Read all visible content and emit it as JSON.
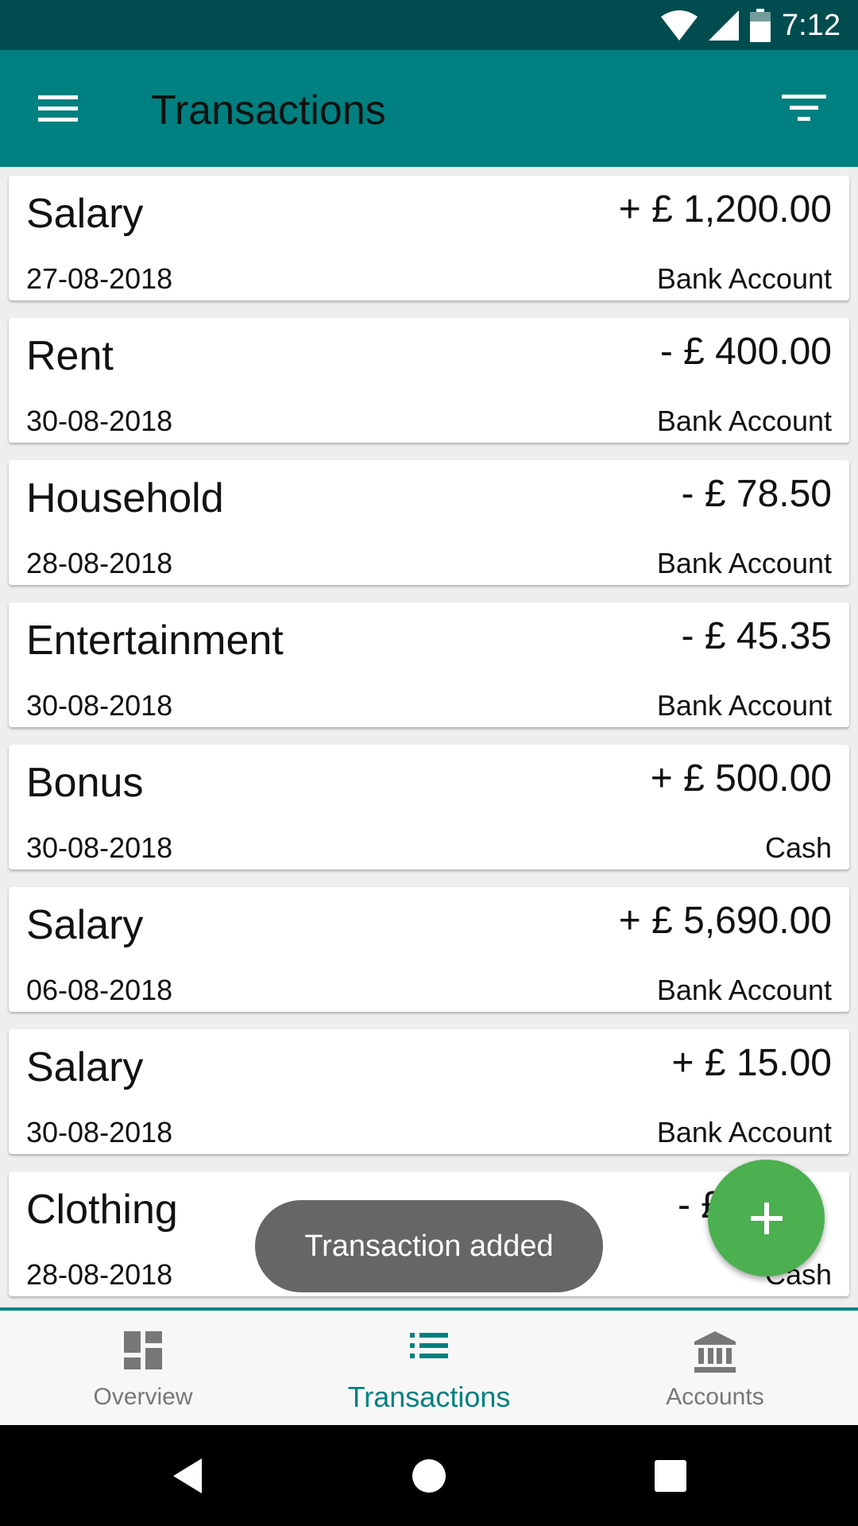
{
  "status_bar": {
    "time": "7:12",
    "icons": [
      "wifi-icon",
      "signal-icon",
      "battery-icon"
    ]
  },
  "app_bar": {
    "title": "Transactions",
    "menu_icon": "menu-icon",
    "filter_icon": "filter-icon"
  },
  "transactions": [
    {
      "title": "Salary",
      "amount": "+ £ 1,200.00",
      "date": "27-08-2018",
      "account": "Bank Account"
    },
    {
      "title": "Rent",
      "amount": "- £ 400.00",
      "date": "30-08-2018",
      "account": "Bank Account"
    },
    {
      "title": "Household",
      "amount": "- £ 78.50",
      "date": "28-08-2018",
      "account": "Bank Account"
    },
    {
      "title": "Entertainment",
      "amount": "- £ 45.35",
      "date": "30-08-2018",
      "account": "Bank Account"
    },
    {
      "title": "Bonus",
      "amount": "+ £ 500.00",
      "date": "30-08-2018",
      "account": "Cash"
    },
    {
      "title": "Salary",
      "amount": "+ £ 5,690.00",
      "date": "06-08-2018",
      "account": "Bank Account"
    },
    {
      "title": "Salary",
      "amount": "+ £ 15.00",
      "date": "30-08-2018",
      "account": "Bank Account"
    },
    {
      "title": "Clothing",
      "amount": "- £",
      "date": "28-08-2018",
      "account": "Cash"
    }
  ],
  "toast": {
    "text": "Transaction added"
  },
  "fab": {
    "icon": "add-icon"
  },
  "bottom_nav": {
    "items": [
      {
        "label": "Overview",
        "icon": "dashboard-icon"
      },
      {
        "label": "Transactions",
        "icon": "list-icon",
        "active": true
      },
      {
        "label": "Accounts",
        "icon": "bank-icon"
      }
    ]
  },
  "colors": {
    "primary": "#008080",
    "status_bar": "#004c4e",
    "fab": "#4caf50",
    "toast": "#666666"
  }
}
